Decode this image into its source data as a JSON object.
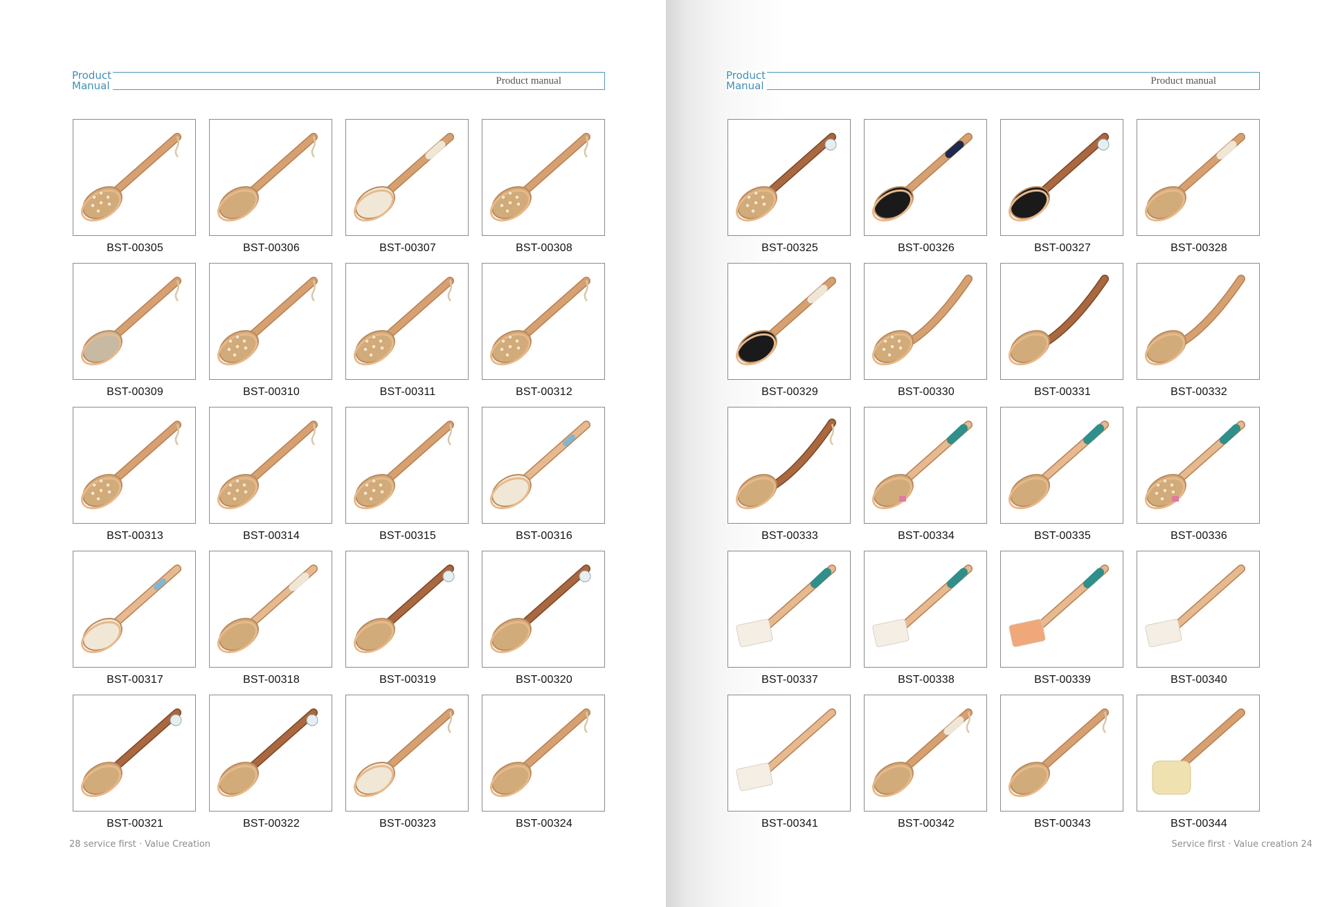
{
  "header": {
    "left_title": "Product\nManual",
    "right_title": "Product manual"
  },
  "left_page": {
    "footer": "28 service first · Value Creation",
    "products": [
      {
        "code": "BST-00305",
        "variant": "knob-head-rope"
      },
      {
        "code": "BST-00306",
        "variant": "plain-rope"
      },
      {
        "code": "BST-00307",
        "variant": "white-wrap-soft"
      },
      {
        "code": "BST-00308",
        "variant": "knob-head-rope"
      },
      {
        "code": "BST-00309",
        "variant": "grey-bristle-rope"
      },
      {
        "code": "BST-00310",
        "variant": "massage-nubs-rope"
      },
      {
        "code": "BST-00311",
        "variant": "massage-nubs-rope"
      },
      {
        "code": "BST-00312",
        "variant": "massage-nubs-rope"
      },
      {
        "code": "BST-00313",
        "variant": "massage-nubs-rope"
      },
      {
        "code": "BST-00314",
        "variant": "massage-nubs-rope"
      },
      {
        "code": "BST-00315",
        "variant": "massage-nubs-rope"
      },
      {
        "code": "BST-00316",
        "variant": "light-blue-stripe"
      },
      {
        "code": "BST-00317",
        "variant": "light-blue-stripe"
      },
      {
        "code": "BST-00318",
        "variant": "light-wrap"
      },
      {
        "code": "BST-00319",
        "variant": "dark-wood-tag"
      },
      {
        "code": "BST-00320",
        "variant": "dark-wood-tag"
      },
      {
        "code": "BST-00321",
        "variant": "dark-wood-tag"
      },
      {
        "code": "BST-00322",
        "variant": "dark-wood-tag"
      },
      {
        "code": "BST-00323",
        "variant": "white-bristle-rope"
      },
      {
        "code": "BST-00324",
        "variant": "plain-rope"
      }
    ]
  },
  "right_page": {
    "footer": "Service first · Value creation 24",
    "products": [
      {
        "code": "BST-00325",
        "variant": "knob-head-tag"
      },
      {
        "code": "BST-00326",
        "variant": "black-navy-wrap"
      },
      {
        "code": "BST-00327",
        "variant": "black-tag"
      },
      {
        "code": "BST-00328",
        "variant": "white-wrap"
      },
      {
        "code": "BST-00329",
        "variant": "black-white-wrap"
      },
      {
        "code": "BST-00330",
        "variant": "curved-knob"
      },
      {
        "code": "BST-00331",
        "variant": "curved-dark"
      },
      {
        "code": "BST-00332",
        "variant": "thin-curved"
      },
      {
        "code": "BST-00333",
        "variant": "curved-dark-rope"
      },
      {
        "code": "BST-00334",
        "variant": "teal-pink"
      },
      {
        "code": "BST-00335",
        "variant": "teal-grip"
      },
      {
        "code": "BST-00336",
        "variant": "teal-pink-knob"
      },
      {
        "code": "BST-00337",
        "variant": "sponge-teal"
      },
      {
        "code": "BST-00338",
        "variant": "sponge-teal-thin"
      },
      {
        "code": "BST-00339",
        "variant": "sponge-teal-orange"
      },
      {
        "code": "BST-00340",
        "variant": "sponge-plain"
      },
      {
        "code": "BST-00341",
        "variant": "sponge-wood"
      },
      {
        "code": "BST-00342",
        "variant": "white-wrap-rope"
      },
      {
        "code": "BST-00343",
        "variant": "plain-rope"
      },
      {
        "code": "BST-00344",
        "variant": "loofah"
      }
    ]
  },
  "colors": {
    "header_blue": "#3f8fb4",
    "wood": "#d7a477",
    "dark_wood": "#a5673f",
    "teal": "#2f8f8a"
  }
}
